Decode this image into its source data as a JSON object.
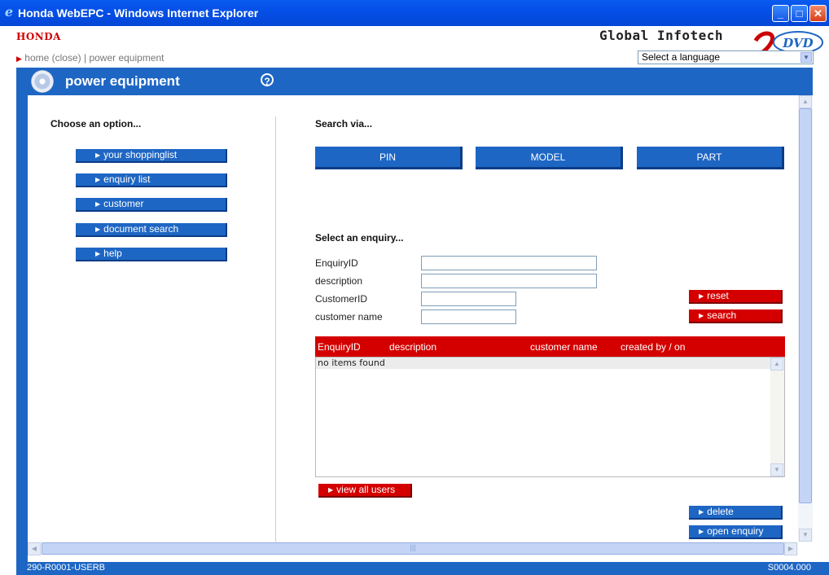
{
  "window": {
    "title": "Honda WebEPC - Windows Internet Explorer",
    "icon": "ie-icon",
    "controls": {
      "minimize": "minimize-icon",
      "maximize": "maximize-icon",
      "close": "close-icon"
    }
  },
  "header": {
    "brand": "HONDA",
    "vendor": "Global Infotech",
    "badge": "DVD",
    "breadcrumb": {
      "home": "home (close)",
      "separator": "|",
      "current": "power equipment"
    },
    "language_select": {
      "value": "Select a language"
    }
  },
  "section": {
    "title": "power equipment",
    "help_icon": "help-icon"
  },
  "left_panel": {
    "heading": "Choose an option...",
    "menu": [
      {
        "label": "your shoppinglist"
      },
      {
        "label": "enquiry list"
      },
      {
        "label": "customer"
      },
      {
        "label": "document search"
      },
      {
        "label": "help"
      }
    ]
  },
  "right_panel": {
    "search_heading": "Search via...",
    "search_buttons": [
      {
        "label": "PIN"
      },
      {
        "label": "MODEL"
      },
      {
        "label": "PART"
      }
    ],
    "enquiry_heading": "Select an enquiry...",
    "form": {
      "enquiry_id": {
        "label": "EnquiryID",
        "value": ""
      },
      "description": {
        "label": "description",
        "value": ""
      },
      "customer_id": {
        "label": "CustomerID",
        "value": ""
      },
      "customer_name": {
        "label": "customer name",
        "value": ""
      }
    },
    "reset_label": "reset",
    "search_label": "search",
    "table": {
      "columns": [
        "EnquiryID",
        "description",
        "customer name",
        "created by / on"
      ],
      "rows": [],
      "empty_message": "no items found"
    },
    "view_all_label": "view all users",
    "delete_label": "delete",
    "open_label": "open enquiry"
  },
  "statusbar": {
    "left": "290-R0001-USERB",
    "right": "S0004.000"
  },
  "colors": {
    "accent_blue": "#1e66c4",
    "accent_red": "#d40000",
    "title_bar": "#0550e8"
  }
}
